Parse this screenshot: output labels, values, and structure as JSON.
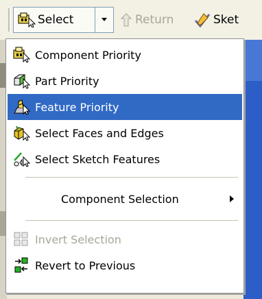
{
  "toolbar": {
    "select_label": "Select",
    "return_label": "Return",
    "sketch_label": "Sket"
  },
  "menu": {
    "items": [
      {
        "label": "Component Priority",
        "icon": "component-priority-icon",
        "state": "normal"
      },
      {
        "label": "Part Priority",
        "icon": "part-priority-icon",
        "state": "normal"
      },
      {
        "label": "Feature Priority",
        "icon": "feature-priority-icon",
        "state": "selected"
      },
      {
        "label": "Select Faces and Edges",
        "icon": "faces-edges-icon",
        "state": "normal"
      },
      {
        "label": "Select Sketch Features",
        "icon": "sketch-features-icon",
        "state": "normal"
      },
      {
        "label": "Component Selection",
        "icon": "",
        "state": "submenu"
      },
      {
        "label": "Invert Selection",
        "icon": "invert-selection-icon",
        "state": "disabled"
      },
      {
        "label": "Revert to Previous",
        "icon": "revert-previous-icon",
        "state": "normal"
      }
    ]
  },
  "colors": {
    "highlight": "#316ac5",
    "disabled_text": "#a6a59a",
    "background": "#ece9d8"
  }
}
